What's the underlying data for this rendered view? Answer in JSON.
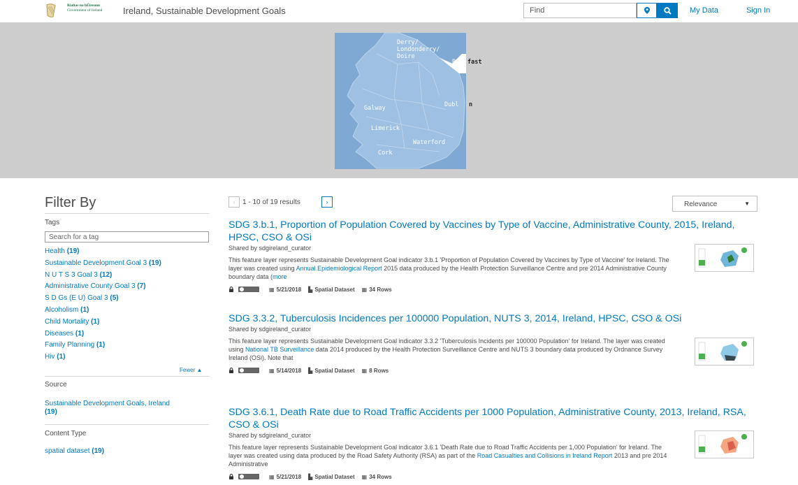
{
  "header": {
    "gov_logo_line1": "Rialtas na hÉireann",
    "gov_logo_line2": "Government of Ireland",
    "site_title": "Ireland, Sustainable Development Goals",
    "find_placeholder": "Find",
    "my_data": "My Data",
    "sign_in": "Sign In"
  },
  "map": {
    "labels": {
      "derry": "Derry/\nLondonderry/\nDoire",
      "belfast_a": "Bel",
      "belfast_b": "fast",
      "galway": "Galway",
      "dublin_a": "Dubl",
      "dublin_b": "n",
      "limerick": "Limerick",
      "waterford": "Waterford",
      "cork": "Cork"
    }
  },
  "filter": {
    "title": "Filter By",
    "tags_label": "Tags",
    "tag_search_placeholder": "Search for a tag",
    "tags": [
      {
        "name": "Health",
        "count": "(19)"
      },
      {
        "name": "Sustainable Development Goal 3",
        "count": "(19)"
      },
      {
        "name": "N U T S 3 Goal 3",
        "count": "(12)"
      },
      {
        "name": "Administrative County Goal 3",
        "count": "(7)"
      },
      {
        "name": "S D Gs (E U) Goal 3",
        "count": "(5)"
      },
      {
        "name": "Alcoholism",
        "count": "(1)"
      },
      {
        "name": "Child Mortality",
        "count": "(1)"
      },
      {
        "name": "Diseases",
        "count": "(1)"
      },
      {
        "name": "Family Planning",
        "count": "(1)"
      },
      {
        "name": "Hiv",
        "count": "(1)"
      }
    ],
    "fewer": "Fewer",
    "source_label": "Source",
    "source_name": "Sustainable Development Goals, Ireland",
    "source_count": "(19)",
    "content_type_label": "Content Type",
    "content_type_name": "spatial dataset",
    "content_type_count": "(19)"
  },
  "results": {
    "pager": {
      "prev": "‹",
      "count_text": "1 - 10 of 19 results",
      "next": "›"
    },
    "sort": "Relevance",
    "items": [
      {
        "title": "SDG 3.b.1, Proportion of Population Covered by Vaccines by Type of Vaccine, Administrative County, 2015, Ireland, HPSC, CSO & OSi",
        "shared": "Shared by sdgireland_curator",
        "desc_1": "This feature layer represents Sustainable Development Goal indicator 3.b.1 'Proportion of Population Covered by Vaccines by Type of Vaccine' for Ireland. The layer was created using ",
        "link": "Annual Epidemiological Report",
        "desc_2": " 2015 data produced by the Health Protection Surveillance Centre and pre 2014 Administrative County boundary data (",
        "more": "more",
        "date": "5/21/2018",
        "type": "Spatial Dataset",
        "rows": "34 Rows"
      },
      {
        "title": "SDG 3.3.2, Tuberculosis Incidences per 100000 Population, NUTS 3, 2014, Ireland, HPSC, CSO & OSi",
        "shared": "Shared by sdgireland_curator",
        "desc_1": "This feature layer represents Sustainable Development Goal indicator 3.3.2 'Tuberculosis Incidents per 100000 Population' for Ireland. The layer was created using ",
        "link": "National TB Surveillance",
        "desc_2": " data 2014 produced by the Health Protection Surveillance Centre and NUTS 3 boundary data produced by Ordnance Survey Ireland (OSi). Note that",
        "more": "",
        "date": "5/14/2018",
        "type": "Spatial Dataset",
        "rows": "8 Rows"
      },
      {
        "title": "SDG 3.6.1, Death Rate due to Road Traffic Accidents per 1000 Population, Administrative County, 2013, Ireland, RSA, CSO & OSi",
        "shared": "Shared by sdgireland_curator",
        "desc_1": "This feature layer represents Sustainable Development Goal indicator 3.6.1 'Death Rate due to Road Traffic Accidents per 1,000 Population' for Ireland. The layer was created using data produced by the Road Safety Authority (RSA) as part of the ",
        "link": "Road Casualties and Collisions in Ireland Report",
        "desc_2": " 2013 and pre 2014 Administrative",
        "more": "",
        "date": "5/21/2018",
        "type": "Spatial Dataset",
        "rows": "34 Rows"
      }
    ]
  },
  "colors": {
    "accent": "#0079c1",
    "banner_bg": "#cdcdcd",
    "map_water": "#7fa9d3",
    "map_land": "#9ec0e2",
    "text": "#4c4c4c"
  }
}
